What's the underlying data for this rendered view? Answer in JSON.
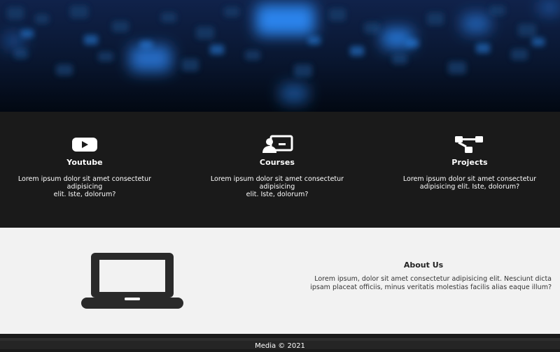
{
  "hero": {
    "icon": "blurred-blue-lights-image"
  },
  "features": [
    {
      "icon": "youtube-icon",
      "title": "Youtube",
      "desc_line1": "Lorem ipsum dolor sit amet consectetur",
      "desc_line2": "adipisicing",
      "desc_line3": "elit. Iste, dolorum?"
    },
    {
      "icon": "presentation-icon",
      "title": "Courses",
      "desc_line1": "Lorem ipsum dolor sit amet consectetur",
      "desc_line2": "adipisicing",
      "desc_line3": "elit. Iste, dolorum?"
    },
    {
      "icon": "project-diagram-icon",
      "title": "Projects",
      "desc_line1": "Lorem ipsum dolor sit amet consectetur",
      "desc_line2": "adipisicing elit. Iste, dolorum?"
    }
  ],
  "about": {
    "icon": "laptop-icon",
    "title": "About Us",
    "text": "Lorem ipsum, dolor sit amet consectetur adipisicing elit. Nesciunt dicta ipsam placeat officiis, minus veritatis molestias facilis alias eaque illum?"
  },
  "footer": {
    "text": "Media © 2021"
  },
  "colors": {
    "dark_section": "#1a1a1a",
    "light_section": "#f2f2f2",
    "footer": "#252525",
    "accent_blue": "#1e90ff"
  }
}
